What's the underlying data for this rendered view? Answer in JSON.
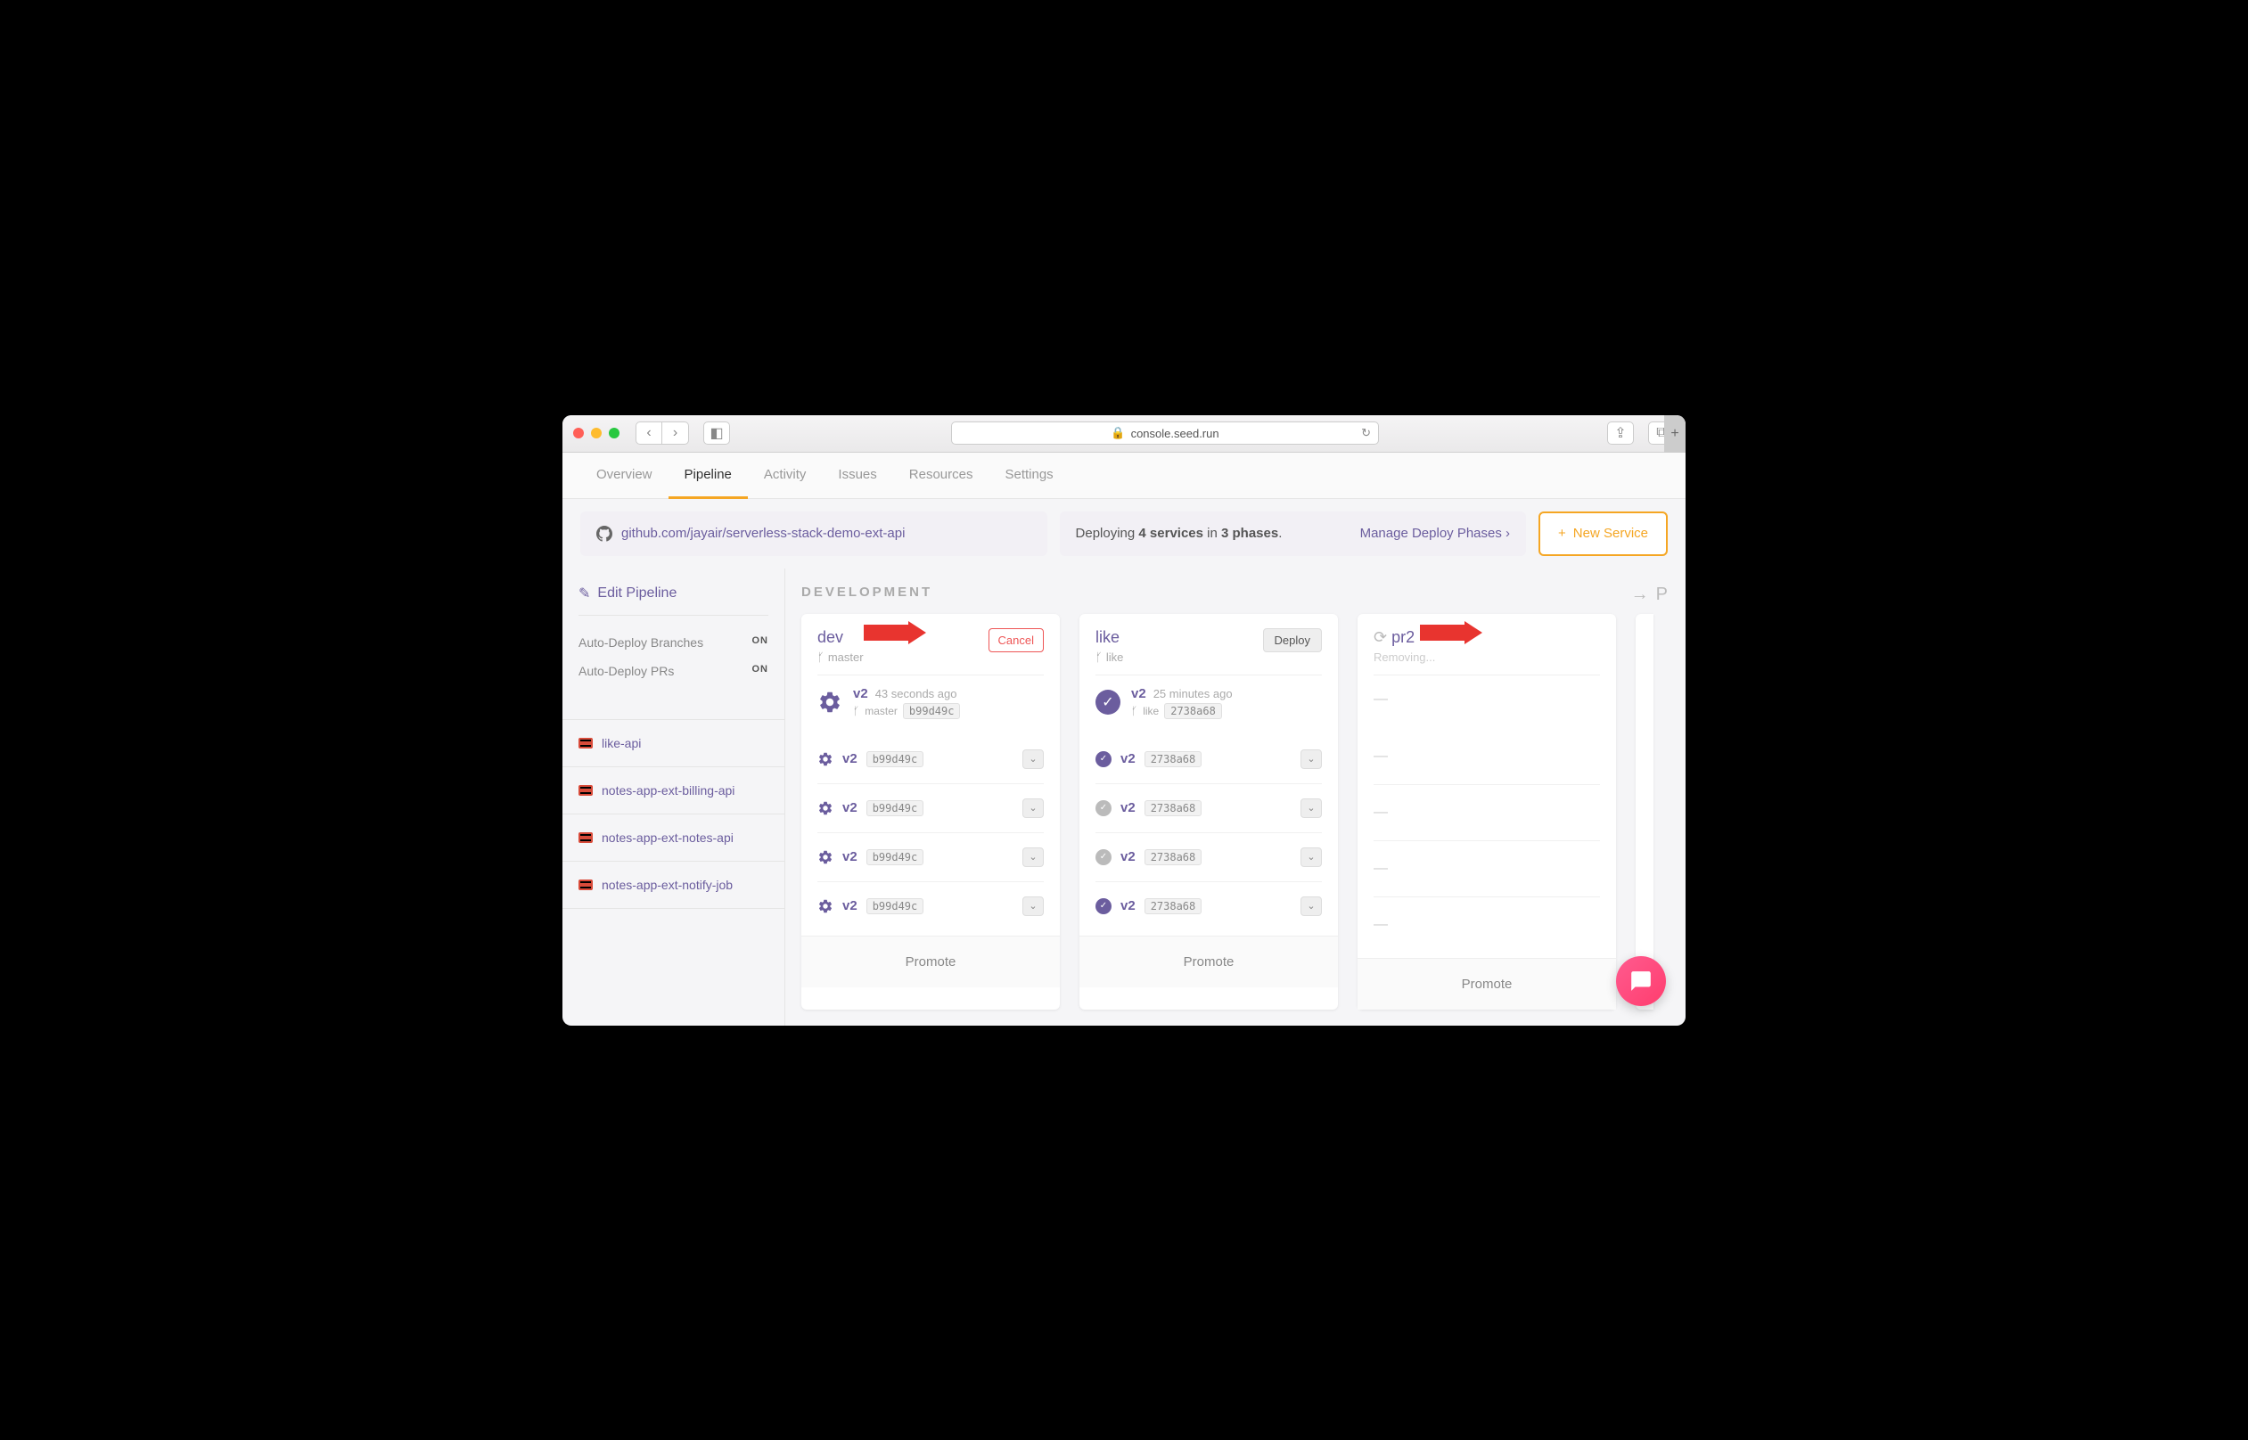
{
  "browser": {
    "url": "console.seed.run"
  },
  "tabs": [
    "Overview",
    "Pipeline",
    "Activity",
    "Issues",
    "Resources",
    "Settings"
  ],
  "active_tab": "Pipeline",
  "repo": {
    "label": "github.com/jayair/serverless-stack-demo-ext-api"
  },
  "deploy_status": {
    "prefix": "Deploying ",
    "services": "4 services",
    "mid": " in ",
    "phases": "3 phases",
    "suffix": "."
  },
  "manage_link": "Manage Deploy Phases",
  "new_service": "New Service",
  "sidebar": {
    "edit": "Edit Pipeline",
    "rows": [
      {
        "label": "Auto-Deploy Branches",
        "value": "ON"
      },
      {
        "label": "Auto-Deploy PRs",
        "value": "ON"
      }
    ],
    "services": [
      "like-api",
      "notes-app-ext-billing-api",
      "notes-app-ext-notes-api",
      "notes-app-ext-notify-job"
    ]
  },
  "section": "DEVELOPMENT",
  "next_section_peek": "P",
  "environments": [
    {
      "name": "dev",
      "branch": "master",
      "action": "Cancel",
      "action_style": "cancel",
      "status": "building",
      "build": {
        "version": "v2",
        "time": "43 seconds ago",
        "branch": "master",
        "hash": "b99d49c"
      },
      "rows": [
        {
          "icon": "gear",
          "version": "v2",
          "hash": "b99d49c"
        },
        {
          "icon": "gear",
          "version": "v2",
          "hash": "b99d49c"
        },
        {
          "icon": "gear",
          "version": "v2",
          "hash": "b99d49c"
        },
        {
          "icon": "gear",
          "version": "v2",
          "hash": "b99d49c"
        }
      ],
      "promote": "Promote",
      "arrow": true
    },
    {
      "name": "like",
      "branch": "like",
      "action": "Deploy",
      "action_style": "deploy",
      "status": "success",
      "build": {
        "version": "v2",
        "time": "25 minutes ago",
        "branch": "like",
        "hash": "2738a68"
      },
      "rows": [
        {
          "icon": "check",
          "version": "v2",
          "hash": "2738a68"
        },
        {
          "icon": "check-grey",
          "version": "v2",
          "hash": "2738a68"
        },
        {
          "icon": "check-grey",
          "version": "v2",
          "hash": "2738a68"
        },
        {
          "icon": "check",
          "version": "v2",
          "hash": "2738a68"
        }
      ],
      "promote": "Promote",
      "arrow": false
    },
    {
      "name": "pr2",
      "branch": "",
      "action": "",
      "action_style": "",
      "status": "removing",
      "removing": "Removing...",
      "rows": [
        {
          "dash": true
        },
        {
          "dash": true
        },
        {
          "dash": true
        },
        {
          "dash": true
        }
      ],
      "build_dash": "—",
      "promote": "Promote",
      "arrow": true
    }
  ]
}
